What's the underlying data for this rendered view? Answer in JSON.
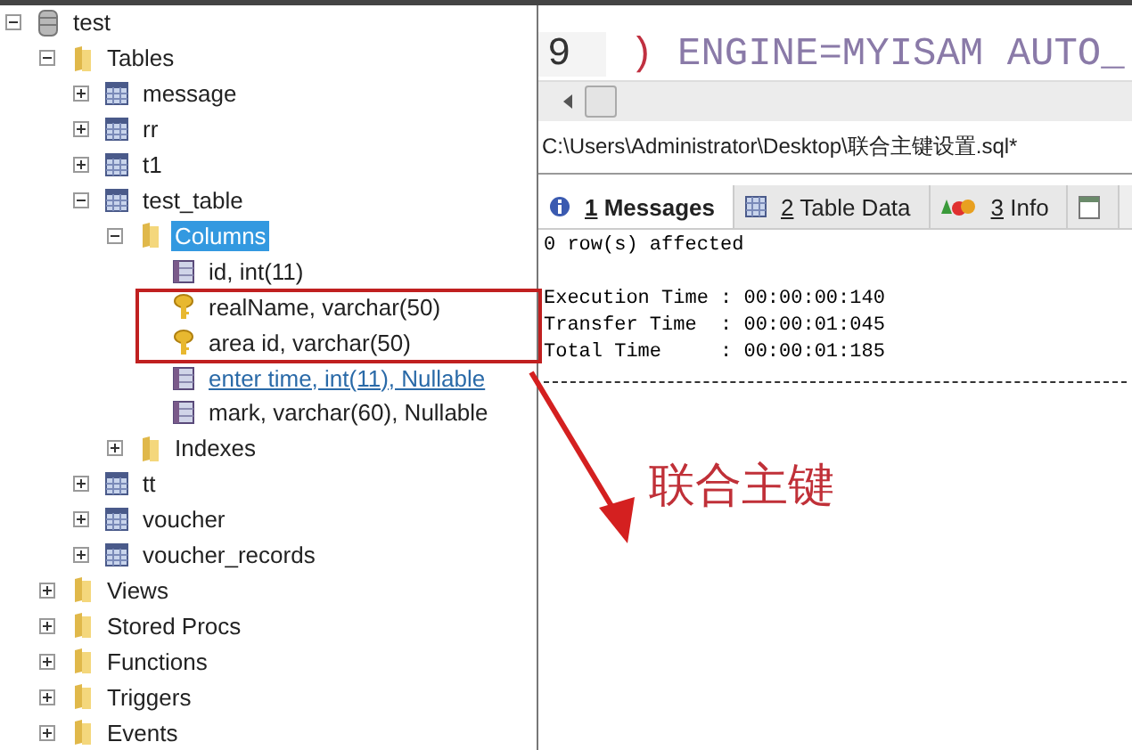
{
  "tree": [
    {
      "label": "test",
      "kind": "database",
      "expanded": true,
      "selected": false,
      "hovered": false,
      "children": [
        {
          "label": "Tables",
          "kind": "folder",
          "expanded": true,
          "selected": false,
          "hovered": false,
          "children": [
            {
              "label": "message",
              "kind": "table",
              "expanded": false,
              "selected": false,
              "hovered": false
            },
            {
              "label": "rr",
              "kind": "table",
              "expanded": false,
              "selected": false,
              "hovered": false
            },
            {
              "label": "t1",
              "kind": "table",
              "expanded": false,
              "selected": false,
              "hovered": false
            },
            {
              "label": "test_table",
              "kind": "table",
              "expanded": true,
              "selected": false,
              "hovered": false,
              "children": [
                {
                  "label": "Columns",
                  "kind": "folder",
                  "expanded": true,
                  "selected": true,
                  "hovered": false,
                  "children": [
                    {
                      "label": "id, int(11)",
                      "kind": "column",
                      "selected": false,
                      "hovered": false
                    },
                    {
                      "label": "realName, varchar(50)",
                      "kind": "key",
                      "selected": false,
                      "hovered": false
                    },
                    {
                      "label": "area id, varchar(50)",
                      "kind": "key",
                      "selected": false,
                      "hovered": false
                    },
                    {
                      "label": "enter time, int(11), Nullable",
                      "kind": "column",
                      "selected": false,
                      "hovered": true
                    },
                    {
                      "label": "mark, varchar(60), Nullable",
                      "kind": "column",
                      "selected": false,
                      "hovered": false
                    }
                  ]
                },
                {
                  "label": "Indexes",
                  "kind": "folder",
                  "expanded": false,
                  "selected": false,
                  "hovered": false
                }
              ]
            },
            {
              "label": "tt",
              "kind": "table",
              "expanded": false,
              "selected": false,
              "hovered": false
            },
            {
              "label": "voucher",
              "kind": "table",
              "expanded": false,
              "selected": false,
              "hovered": false
            },
            {
              "label": "voucher_records",
              "kind": "table",
              "expanded": false,
              "selected": false,
              "hovered": false
            }
          ]
        },
        {
          "label": "Views",
          "kind": "folder",
          "expanded": false,
          "selected": false,
          "hovered": false
        },
        {
          "label": "Stored Procs",
          "kind": "folder",
          "expanded": false,
          "selected": false,
          "hovered": false
        },
        {
          "label": "Functions",
          "kind": "folder",
          "expanded": false,
          "selected": false,
          "hovered": false
        },
        {
          "label": "Triggers",
          "kind": "folder",
          "expanded": false,
          "selected": false,
          "hovered": false
        },
        {
          "label": "Events",
          "kind": "folder",
          "expanded": false,
          "selected": false,
          "hovered": false
        }
      ]
    }
  ],
  "editor": {
    "lines": [
      {
        "number": "9",
        "paren": ")",
        "code": "ENGINE=MYISAM AUTO_"
      }
    ]
  },
  "file_path": "C:\\Users\\Administrator\\Desktop\\联合主键设置.sql*",
  "tabs": [
    {
      "number": "1",
      "label": "Messages",
      "kind": "messages",
      "selected": true
    },
    {
      "number": "2",
      "label": "Table Data",
      "kind": "table",
      "selected": false
    },
    {
      "number": "3",
      "label": "Info",
      "kind": "info",
      "selected": false
    },
    {
      "kind": "calendar",
      "selected": false
    }
  ],
  "messages": [
    "0 row(s) affected",
    "Execution Time : 00:00:00:140",
    "Transfer Time  : 00:00:01:045",
    "Total Time     : 00:00:01:185"
  ],
  "annotation": {
    "label": "联合主键"
  }
}
